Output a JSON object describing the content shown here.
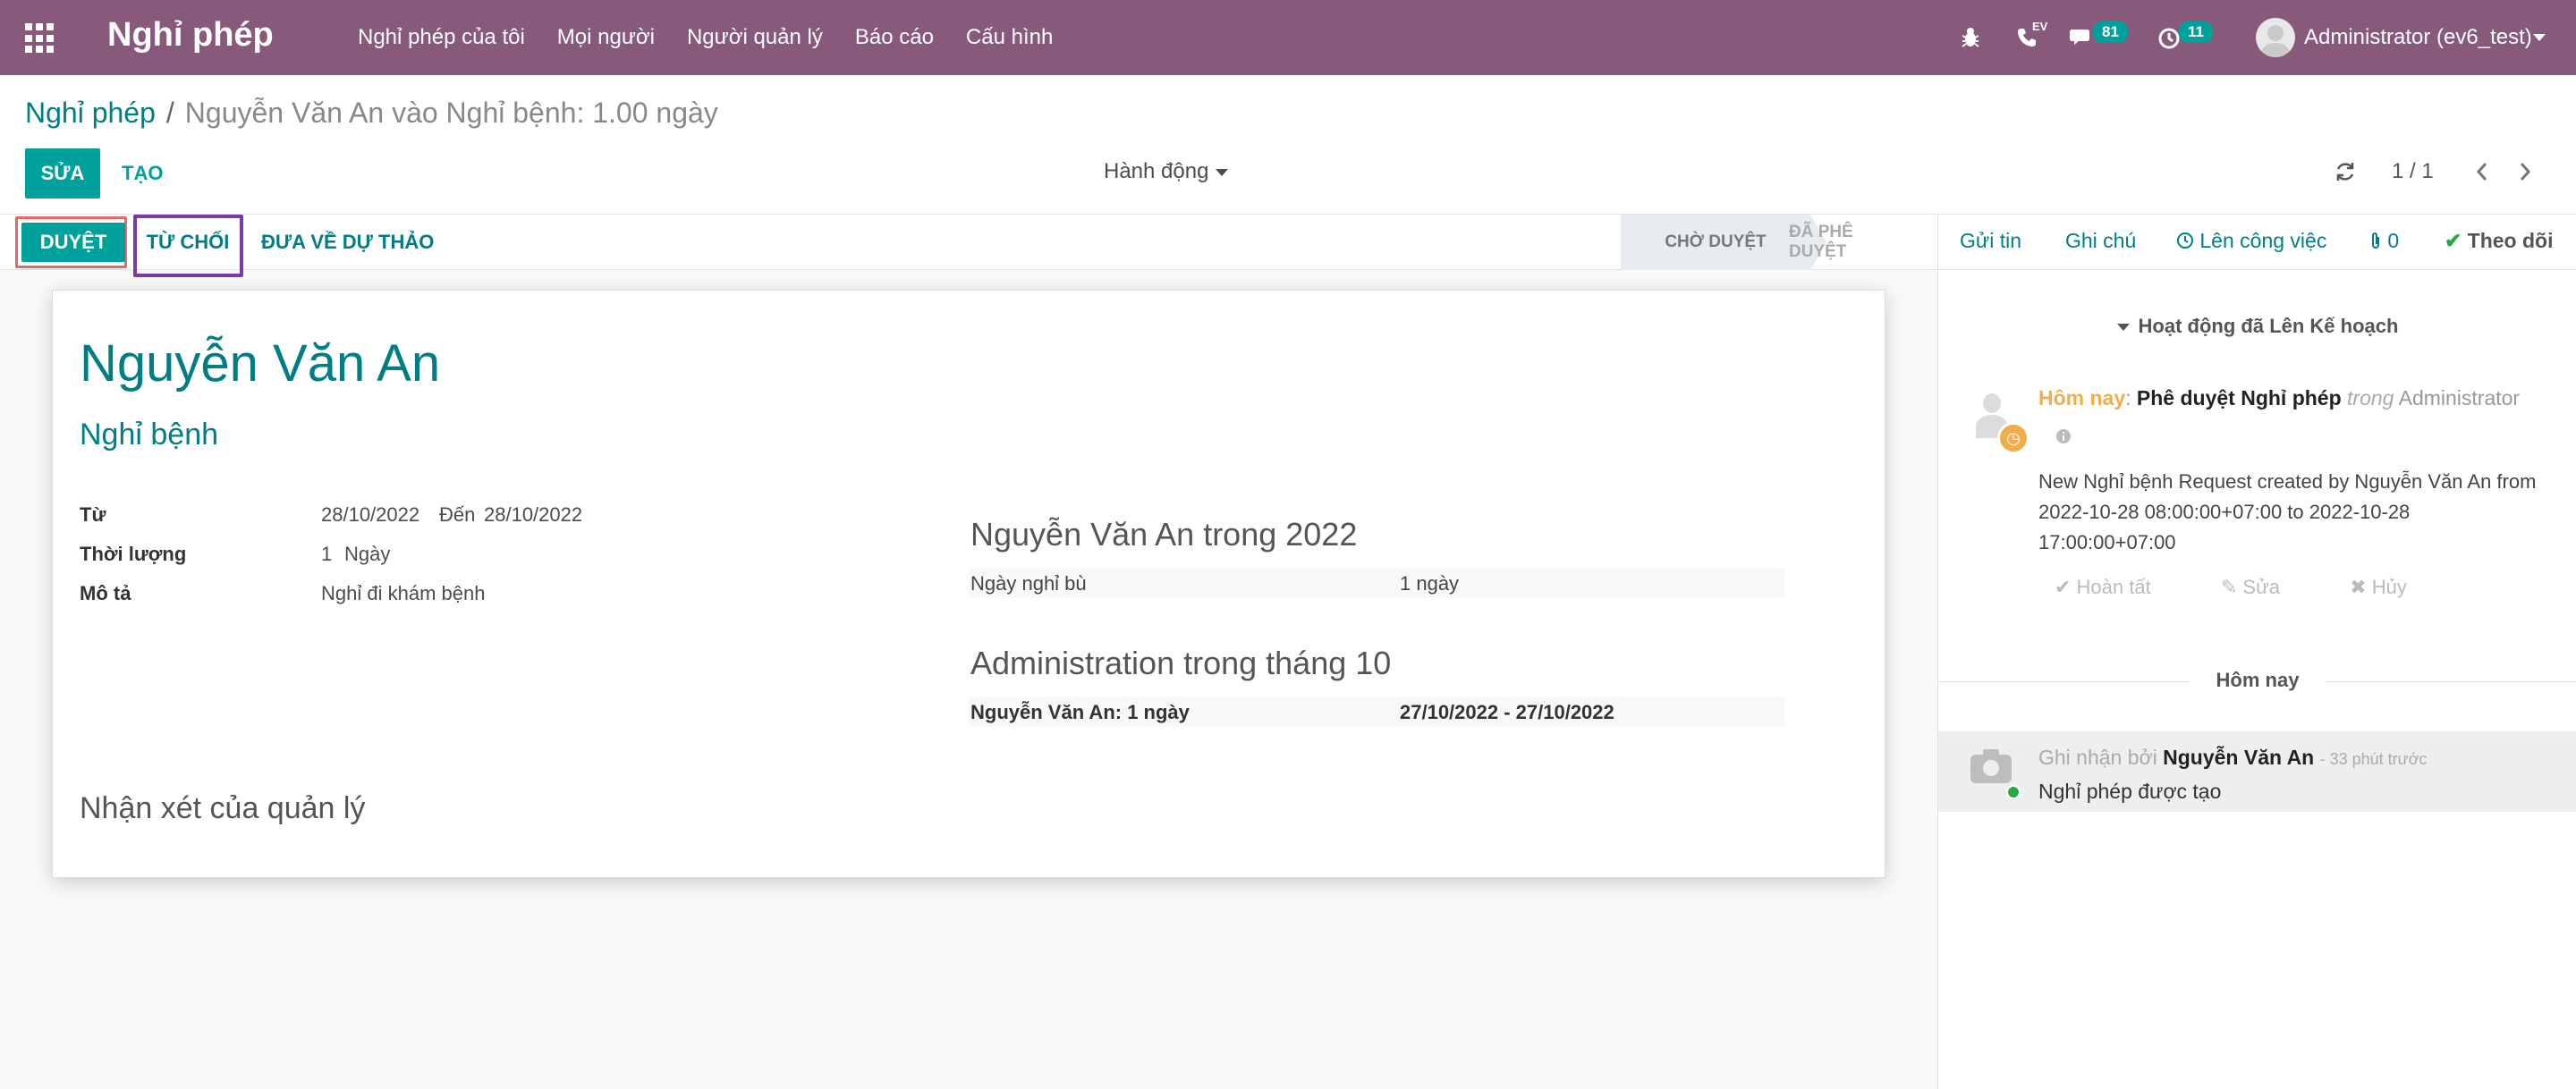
{
  "app": {
    "brand": "Nghỉ phép",
    "menu": [
      "Nghỉ phép của tôi",
      "Mọi người",
      "Người quản lý",
      "Báo cáo",
      "Cấu hình"
    ],
    "systray": {
      "ev_label": "EV",
      "messages_count": "81",
      "activities_count": "11",
      "user_name": "Administrator (ev6_test)"
    }
  },
  "breadcrumb": {
    "parent": "Nghỉ phép",
    "separator": "/",
    "current": "Nguyễn Văn An vào Nghỉ bệnh: 1.00 ngày"
  },
  "control": {
    "edit_label": "SỬA",
    "create_label": "TẠO",
    "action_label": "Hành động",
    "pager": "1 / 1"
  },
  "statusbar": {
    "approve_label": "DUYỆT",
    "refuse_label": "TỪ CHỐI",
    "reset_label": "ĐƯA VỀ DỰ THẢO",
    "stages": [
      "CHỜ DUYỆT",
      "ĐÃ PHÊ DUYỆT"
    ]
  },
  "form": {
    "employee": "Nguyễn Văn An",
    "leave_type": "Nghỉ bệnh",
    "from_label": "Từ",
    "date_from": "28/10/2022",
    "to_label": "Đến",
    "date_to": "28/10/2022",
    "duration_label": "Thời lượng",
    "duration_value": "1",
    "duration_unit": "Ngày",
    "description_label": "Mô tả",
    "description_value": "Nghỉ đi khám bệnh",
    "manager_note_label": "Nhận xét của quản lý"
  },
  "summary": {
    "year_title": "Nguyễn Văn An trong 2022",
    "year_rows": [
      {
        "label": "Ngày nghỉ bù",
        "value": "1 ngày"
      }
    ],
    "month_title": "Administration trong tháng 10",
    "month_rows": [
      {
        "label": "Nguyễn Văn An: 1 ngày",
        "value": "27/10/2022 - 27/10/2022"
      }
    ]
  },
  "chatter": {
    "send_message": "Gửi tin",
    "log_note": "Ghi chú",
    "schedule_activity": "Lên công việc",
    "attachments": "0",
    "follow": "Theo dõi",
    "activities_header": "Hoạt động đã Lên Kế hoạch",
    "activity": {
      "when": "Hôm nay",
      "colon": ":",
      "summary": "Phê duyệt Nghỉ phép",
      "in_word": "trong",
      "assignee": "Administrator",
      "note": "New Nghỉ bệnh Request created by Nguyễn Văn An from 2022-10-28 08:00:00+07:00 to 2022-10-28 17:00:00+07:00",
      "done_label": "Hoàn tất",
      "edit_label": "Sửa",
      "cancel_label": "Hủy"
    },
    "today_separator": "Hôm nay",
    "message": {
      "prefix": "Ghi nhận bởi",
      "author": "Nguyễn Văn An",
      "time": "- 33 phút trước",
      "body": "Nghỉ phép được tạo"
    }
  },
  "colors": {
    "navbar": "#875a7b",
    "primary": "#00a09d",
    "link": "#017e84",
    "highlight_red": "#e46869",
    "highlight_purple": "#7b3aa4"
  }
}
